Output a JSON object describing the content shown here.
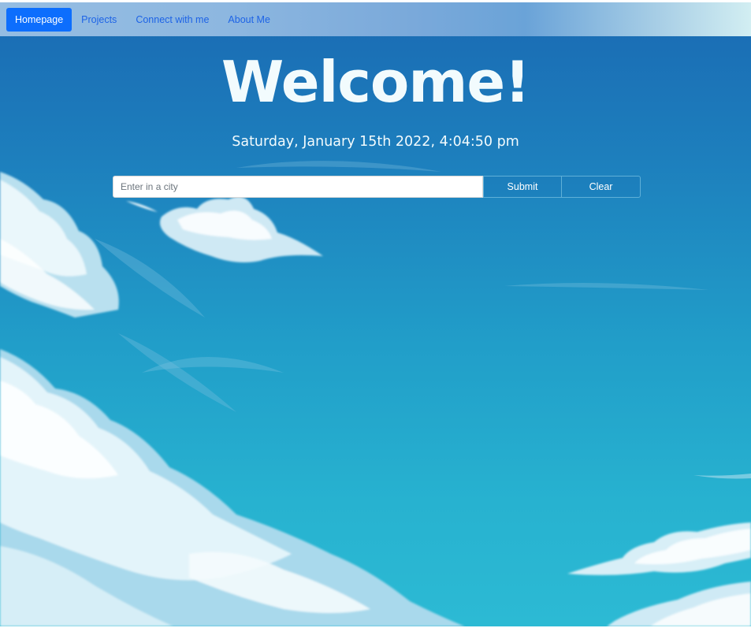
{
  "nav": {
    "items": [
      {
        "label": "Homepage",
        "active": true
      },
      {
        "label": "Projects",
        "active": false
      },
      {
        "label": "Connect with me",
        "active": false
      },
      {
        "label": "About Me",
        "active": false
      }
    ]
  },
  "hero": {
    "heading": "Welcome!",
    "datetime": "Saturday, January 15th 2022, 4:04:50 pm"
  },
  "search": {
    "placeholder": "Enter in a city",
    "value": "",
    "submit_label": "Submit",
    "clear_label": "Clear"
  },
  "colors": {
    "nav_active": "#0d6efd",
    "nav_link": "#1d63e6",
    "sky_top": "#1a6ab3",
    "sky_bottom": "#2cbad4",
    "heading_text": "#f2fbfd"
  },
  "background_icon": "sky-clouds-illustration"
}
